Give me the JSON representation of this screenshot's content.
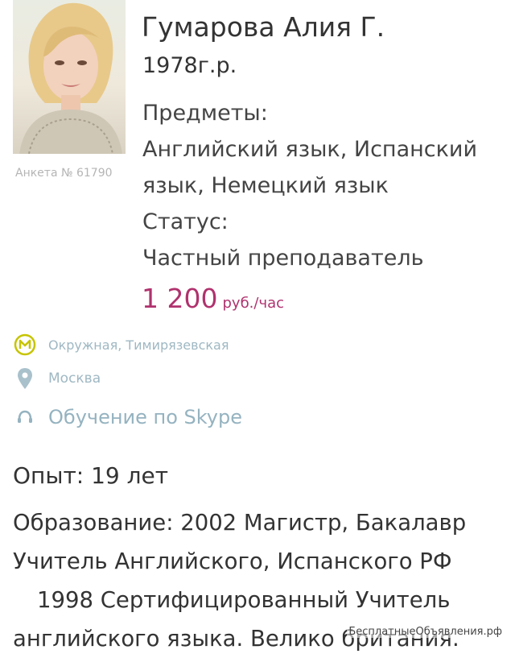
{
  "profile": {
    "name": "Гумарова Алия Г.",
    "birth_year": "1978г.р.",
    "anketa_label": "Анкета № 61790",
    "subjects_label": "Предметы:",
    "subjects_line1": "Английский язык, Испанский",
    "subjects_line2": "язык, Немецкий язык",
    "status_label": "Статус:",
    "status_value": "Частный преподаватель",
    "price_value": "1 200",
    "price_unit": "руб./час"
  },
  "location": {
    "metro": "Окружная, Тимирязевская",
    "city": "Москва",
    "skype": "Обучение по Skype"
  },
  "details": {
    "experience": "Опыт: 19 лет",
    "education_line1": "Образование:  2002 Магистр, Бакалавр",
    "education_line2": "Учитель Английского, Испанского РФ",
    "education_line3": "1998 Сертифицированный Учитель",
    "education_line4": "английского языка. Велико британия."
  },
  "watermark": "БесплатныеОбъявления.рф",
  "colors": {
    "price": "#b0326e",
    "metro_badge": "#c6c400",
    "location_text": "#9fb8c3"
  },
  "icons": {
    "metro": "metro-icon",
    "city": "location-pin-icon",
    "skype": "skype-icon"
  }
}
